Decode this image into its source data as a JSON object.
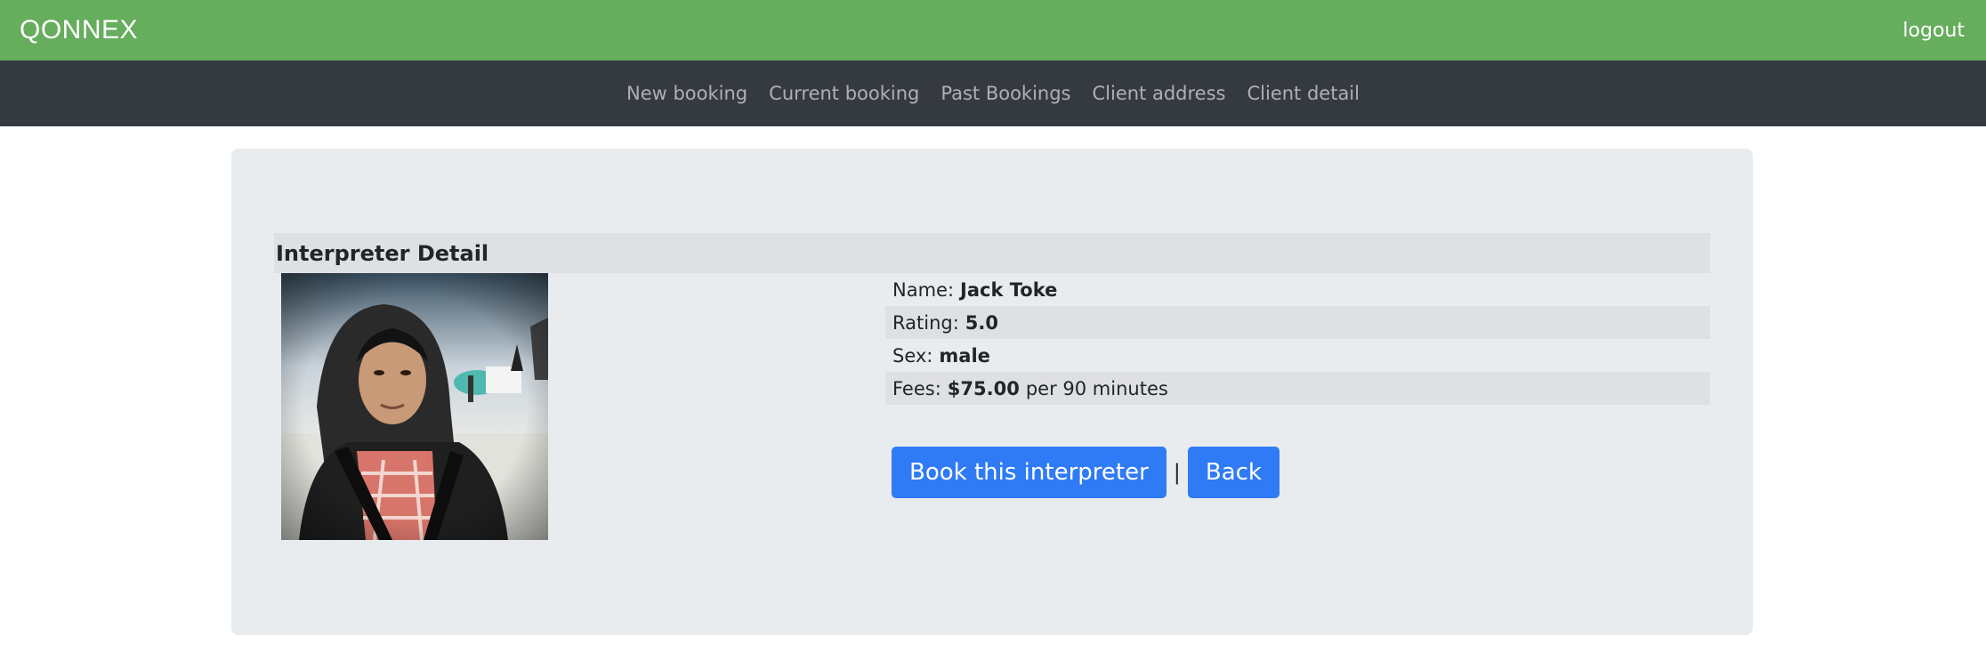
{
  "header": {
    "brand": "QONNEX",
    "logout_label": "logout"
  },
  "nav": {
    "items": [
      "New booking",
      "Current booking",
      "Past Bookings",
      "Client address",
      "Client detail"
    ]
  },
  "detail": {
    "section_title": "Interpreter Detail",
    "name_label": "Name:",
    "name_value": "Jack Toke",
    "rating_label": "Rating:",
    "rating_value": "5.0",
    "sex_label": "Sex:",
    "sex_value": "male",
    "fees_label": "Fees:",
    "fees_value": "$75.00",
    "fees_suffix": "per 90 minutes"
  },
  "actions": {
    "book_label": "Book this interpreter",
    "separator": "|",
    "back_label": "Back"
  }
}
